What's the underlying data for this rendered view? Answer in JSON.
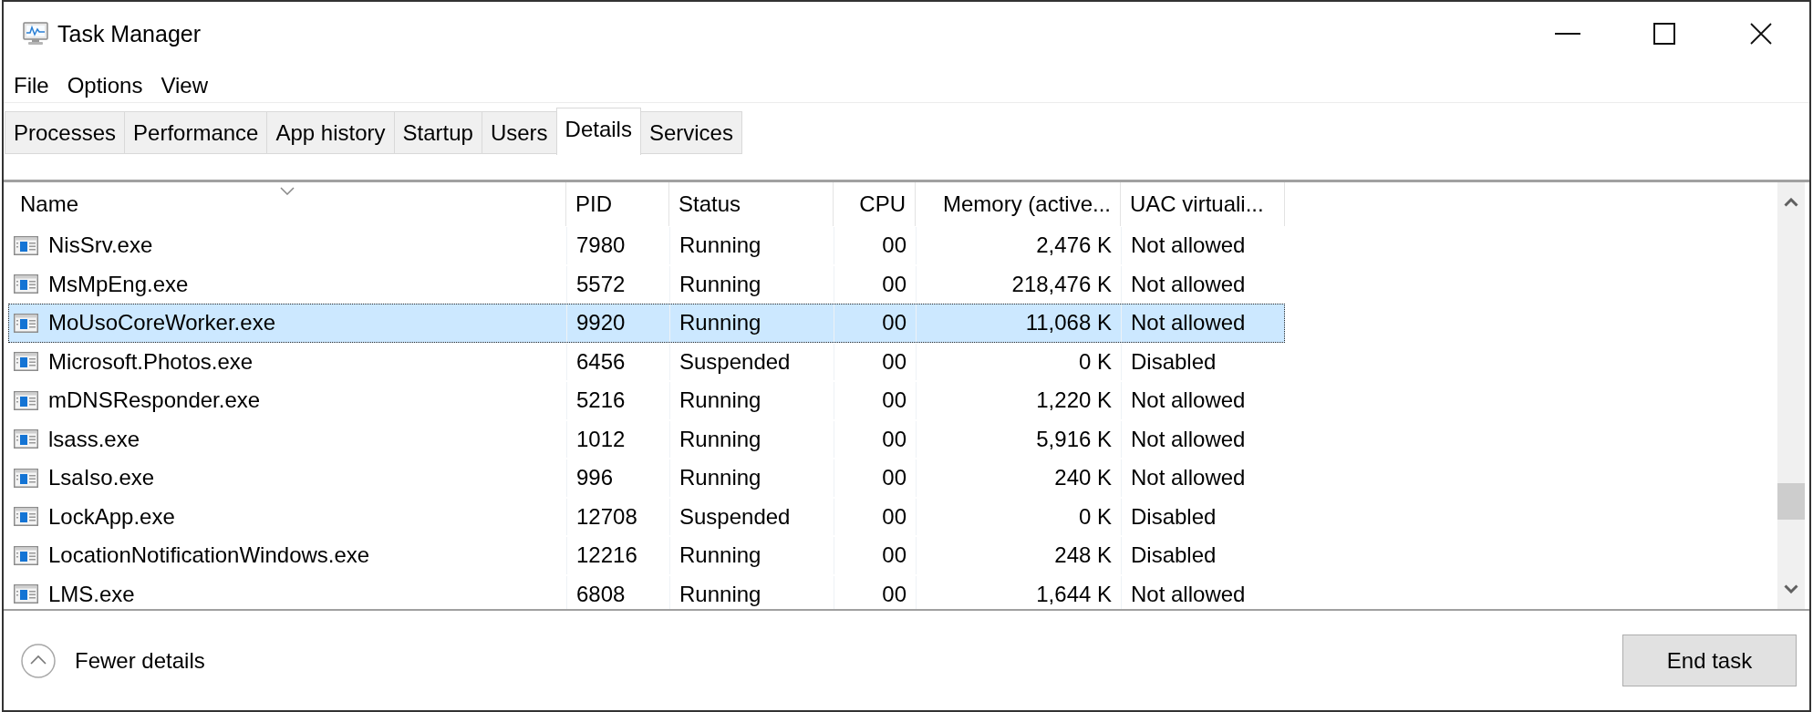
{
  "window": {
    "title": "Task Manager"
  },
  "menu": [
    "File",
    "Options",
    "View"
  ],
  "tabs": [
    {
      "label": "Processes",
      "selected": false
    },
    {
      "label": "Performance",
      "selected": false
    },
    {
      "label": "App history",
      "selected": false
    },
    {
      "label": "Startup",
      "selected": false
    },
    {
      "label": "Users",
      "selected": false
    },
    {
      "label": "Details",
      "selected": true
    },
    {
      "label": "Services",
      "selected": false
    }
  ],
  "table": {
    "columns": [
      {
        "label": "Name",
        "kind": "text",
        "sorted": true
      },
      {
        "label": "PID",
        "kind": "text",
        "sorted": false
      },
      {
        "label": "Status",
        "kind": "text",
        "sorted": false
      },
      {
        "label": "CPU",
        "kind": "number",
        "sorted": false
      },
      {
        "label": "Memory (active...",
        "kind": "number",
        "sorted": false
      },
      {
        "label": "UAC virtuali...",
        "kind": "text",
        "sorted": false
      }
    ],
    "rows": [
      {
        "cells": [
          "NisSrv.exe",
          "7980",
          "Running",
          "00",
          "2,476 K",
          "Not allowed"
        ],
        "selected": false
      },
      {
        "cells": [
          "MsMpEng.exe",
          "5572",
          "Running",
          "00",
          "218,476 K",
          "Not allowed"
        ],
        "selected": false
      },
      {
        "cells": [
          "MoUsoCoreWorker.exe",
          "9920",
          "Running",
          "00",
          "11,068 K",
          "Not allowed"
        ],
        "selected": true
      },
      {
        "cells": [
          "Microsoft.Photos.exe",
          "6456",
          "Suspended",
          "00",
          "0 K",
          "Disabled"
        ],
        "selected": false
      },
      {
        "cells": [
          "mDNSResponder.exe",
          "5216",
          "Running",
          "00",
          "1,220 K",
          "Not allowed"
        ],
        "selected": false
      },
      {
        "cells": [
          "lsass.exe",
          "1012",
          "Running",
          "00",
          "5,916 K",
          "Not allowed"
        ],
        "selected": false
      },
      {
        "cells": [
          "LsaIso.exe",
          "996",
          "Running",
          "00",
          "240 K",
          "Not allowed"
        ],
        "selected": false
      },
      {
        "cells": [
          "LockApp.exe",
          "12708",
          "Suspended",
          "00",
          "0 K",
          "Disabled"
        ],
        "selected": false
      },
      {
        "cells": [
          "LocationNotificationWindows.exe",
          "12216",
          "Running",
          "00",
          "248 K",
          "Disabled"
        ],
        "selected": false
      },
      {
        "cells": [
          "LMS.exe",
          "6808",
          "Running",
          "00",
          "1,644 K",
          "Not allowed"
        ],
        "selected": false
      }
    ]
  },
  "footer": {
    "toggle": "Fewer details",
    "button": "End task"
  }
}
